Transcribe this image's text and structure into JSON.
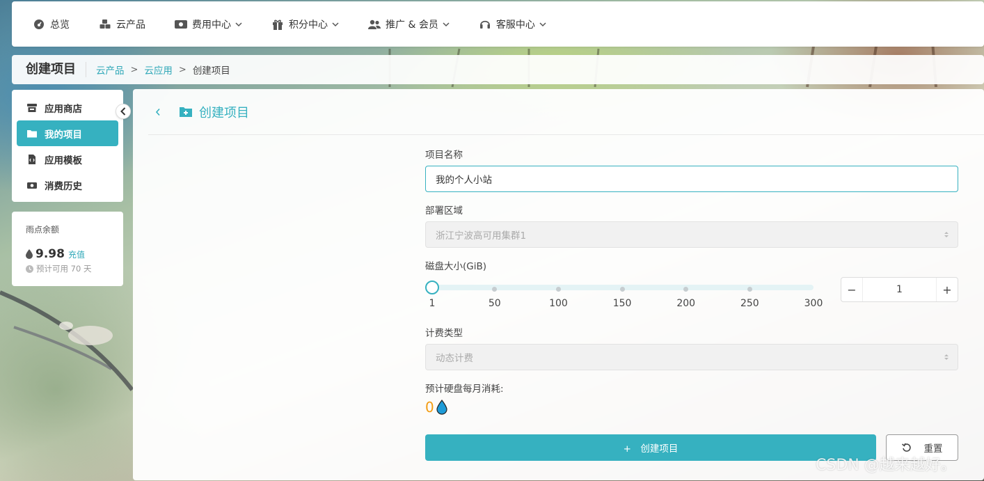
{
  "nav": {
    "items": [
      {
        "label": "总览",
        "icon": "dashboard-icon",
        "dropdown": false
      },
      {
        "label": "云产品",
        "icon": "cubes-icon",
        "dropdown": false
      },
      {
        "label": "费用中心",
        "icon": "money-bill-icon",
        "dropdown": true
      },
      {
        "label": "积分中心",
        "icon": "gift-icon",
        "dropdown": true
      },
      {
        "label": "推广 & 会员",
        "icon": "users-icon",
        "dropdown": true
      },
      {
        "label": "客服中心",
        "icon": "headset-icon",
        "dropdown": true
      }
    ]
  },
  "breadcrumb": {
    "title": "创建项目",
    "items": [
      "云产品",
      "云应用",
      "创建项目"
    ],
    "separator": ">"
  },
  "sidebar": {
    "items": [
      {
        "label": "应用商店",
        "icon": "store-icon",
        "active": false
      },
      {
        "label": "我的项目",
        "icon": "folder-icon",
        "active": true
      },
      {
        "label": "应用模板",
        "icon": "file-code-icon",
        "active": false
      },
      {
        "label": "消费历史",
        "icon": "money-bill-icon",
        "active": false
      }
    ],
    "collapse_icon": "chevron-left-icon"
  },
  "balance": {
    "label": "雨点余额",
    "value": "9.98",
    "recharge": "充值",
    "estimate": "预计可用 70 天"
  },
  "page": {
    "title": "创建项目",
    "back_icon": "chevron-left-icon",
    "title_icon": "folder-plus-icon"
  },
  "form": {
    "name_label": "项目名称",
    "name_value": "我的个人小站",
    "region_label": "部署区域",
    "region_value": "浙江宁波高可用集群1",
    "disk_label": "磁盘大小(GiB)",
    "disk_ticks": [
      "1",
      "50",
      "100",
      "150",
      "200",
      "250",
      "300"
    ],
    "disk_value": "1",
    "disk_min": 1,
    "disk_max": 300,
    "stepper_minus": "−",
    "stepper_plus": "+",
    "billing_label": "计费类型",
    "billing_value": "动态计费",
    "cost_label": "预计硬盘每月消耗:",
    "cost_value": "0"
  },
  "buttons": {
    "create": "+　创建项目",
    "reset": "重置"
  },
  "watermark": "CSDN @越来越好。",
  "colors": {
    "accent": "#36b1c0",
    "cost": "#f39c12",
    "drop": "#1e9bd7"
  }
}
